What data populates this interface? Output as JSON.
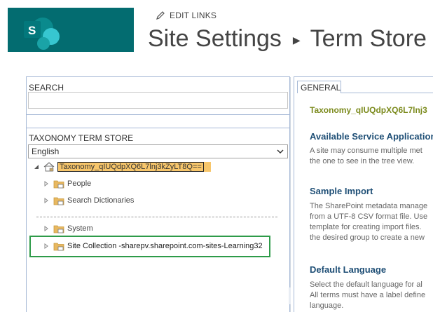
{
  "header": {
    "edit_links": "EDIT LINKS",
    "title_part1": "Site Settings",
    "title_sep": "▶",
    "title_part2": "Term Store M",
    "colors": {
      "logo_bg": "#036c70",
      "title_text": "#444444"
    }
  },
  "left": {
    "search_label": "SEARCH",
    "search_value": "",
    "taxonomy_label": "TAXONOMY TERM STORE",
    "language_selected": "English",
    "tree": {
      "root": "Taxonomy_qIUQdpXQ6L7lnj3kZyLT8Q==",
      "groups": [
        {
          "label": "People"
        },
        {
          "label": "Search Dictionaries"
        },
        {
          "label": "System"
        },
        {
          "label": "Site Collection -sharepv.sharepoint.com-sites-Learning32"
        }
      ]
    },
    "colors": {
      "root_highlight": "#f7c66b",
      "selection_box": "#2e9b49",
      "border": "#a6b9d6"
    }
  },
  "right": {
    "tab": "GENERAL",
    "term_store_name": "Taxonomy_qIUQdpXQ6L7lnj3",
    "sections": [
      {
        "heading": "Available Service Application",
        "lines": [
          "A site may consume multiple met",
          "the one to see in the tree view."
        ]
      },
      {
        "heading": "Sample Import",
        "lines": [
          "The SharePoint metadata manage",
          "from a UTF-8 CSV format file. Use",
          "template for creating import files.",
          "the desired group to create a new"
        ]
      },
      {
        "heading": "Default Language",
        "lines": [
          "Select the default language for al",
          "All terms must have a label define",
          "language."
        ]
      }
    ],
    "colors": {
      "heading": "#1f4f76",
      "title": "#7b8a1c"
    }
  }
}
